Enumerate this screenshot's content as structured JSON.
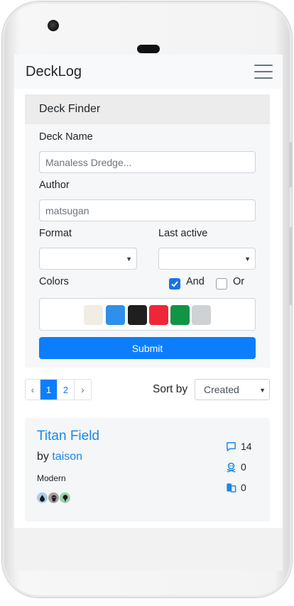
{
  "app": {
    "brand": "DeckLog"
  },
  "finder": {
    "title": "Deck Finder",
    "deck_name_label": "Deck Name",
    "deck_name_placeholder": "Manaless Dredge...",
    "author_label": "Author",
    "author_value": "matsugan",
    "format_label": "Format",
    "format_value": "",
    "last_active_label": "Last active",
    "last_active_value": "",
    "colors_label": "Colors",
    "and_label": "And",
    "or_label": "Or",
    "and_checked": true,
    "or_checked": false,
    "color_swatches": [
      {
        "name": "white",
        "hex": "#f1ede4"
      },
      {
        "name": "blue",
        "hex": "#2f8fea"
      },
      {
        "name": "black",
        "hex": "#1f1f1f"
      },
      {
        "name": "red",
        "hex": "#ef2638"
      },
      {
        "name": "green",
        "hex": "#0f9544"
      },
      {
        "name": "colorless",
        "hex": "#cfd2d4"
      }
    ],
    "submit_label": "Submit"
  },
  "pagination": {
    "prev": "‹",
    "pages": [
      "1",
      "2"
    ],
    "active_page": "1",
    "next": "›"
  },
  "sort": {
    "label": "Sort by",
    "value": "Created"
  },
  "deck": {
    "title": "Titan Field",
    "by_text": "by",
    "author": "taison",
    "format": "Modern",
    "mana_icons": [
      "blue-mana-icon",
      "black-mana-icon",
      "green-mana-icon"
    ],
    "comments": "14",
    "skull_count": "0",
    "copies": "0"
  },
  "colors": {
    "accent": "#0d7efb",
    "link": "#1a86e8"
  }
}
